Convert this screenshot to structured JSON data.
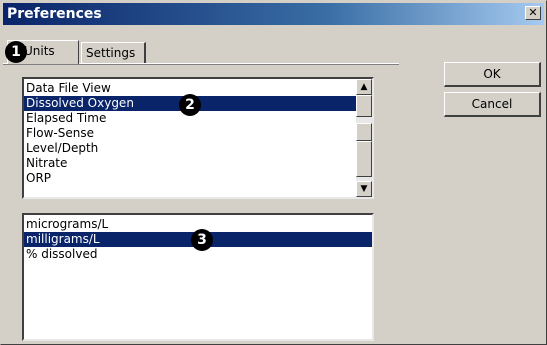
{
  "window": {
    "title": "Preferences",
    "close_glyph": "✕"
  },
  "tabs": [
    {
      "label": "Units",
      "active": true
    },
    {
      "label": "Settings",
      "active": false
    }
  ],
  "markers": [
    "1",
    "2",
    "3"
  ],
  "unit_types": {
    "items": [
      "Data File View",
      "Dissolved Oxygen",
      "Elapsed Time",
      "Flow-Sense",
      "Level/Depth",
      "Nitrate",
      "ORP"
    ],
    "selected": "Dissolved Oxygen"
  },
  "unit_options": {
    "items": [
      "micrograms/L",
      "milligrams/L",
      "% dissolved"
    ],
    "selected": "milligrams/L"
  },
  "buttons": {
    "ok": "OK",
    "cancel": "Cancel"
  },
  "scroll_arrows": {
    "up": "▲",
    "down": "▼"
  },
  "colors": {
    "selection": "#0a246a",
    "titlebar": "#0a246a",
    "face": "#d4d0c8"
  }
}
